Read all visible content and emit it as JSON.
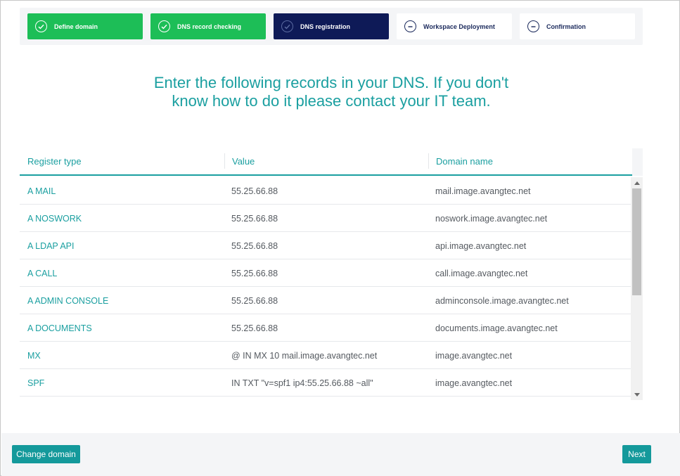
{
  "stepper": {
    "steps": [
      {
        "label": "Define domain",
        "state": "done"
      },
      {
        "label": "DNS record checking",
        "state": "done"
      },
      {
        "label": "DNS registration",
        "state": "active"
      },
      {
        "label": "Workspace Deployment",
        "state": "pending"
      },
      {
        "label": "Confirmation",
        "state": "pending"
      }
    ]
  },
  "heading": "Enter the following records in your DNS. If you don't know how to do it please contact your IT team.",
  "table": {
    "headers": {
      "type": "Register type",
      "value": "Value",
      "domain": "Domain name"
    },
    "rows": [
      {
        "type": "A MAIL",
        "value": "55.25.66.88",
        "domain": "mail.image.avangtec.net"
      },
      {
        "type": "A NOSWORK",
        "value": "55.25.66.88",
        "domain": "noswork.image.avangtec.net"
      },
      {
        "type": "A LDAP API",
        "value": "55.25.66.88",
        "domain": "api.image.avangtec.net"
      },
      {
        "type": "A CALL",
        "value": "55.25.66.88",
        "domain": "call.image.avangtec.net"
      },
      {
        "type": "A ADMIN CONSOLE",
        "value": "55.25.66.88",
        "domain": "adminconsole.image.avangtec.net"
      },
      {
        "type": "A DOCUMENTS",
        "value": "55.25.66.88",
        "domain": "documents.image.avangtec.net"
      },
      {
        "type": "MX",
        "value": "@ IN MX 10 mail.image.avangtec.net",
        "domain": "image.avangtec.net"
      },
      {
        "type": "SPF",
        "value": "IN TXT \"v=spf1 ip4:55.25.66.88 ~all\"",
        "domain": "image.avangtec.net"
      }
    ]
  },
  "footer": {
    "change_domain_label": "Change domain",
    "next_label": "Next"
  },
  "colors": {
    "accent": "#1a9fa0",
    "done": "#1dbe57",
    "active": "#0e1a57",
    "button": "#14999b"
  }
}
